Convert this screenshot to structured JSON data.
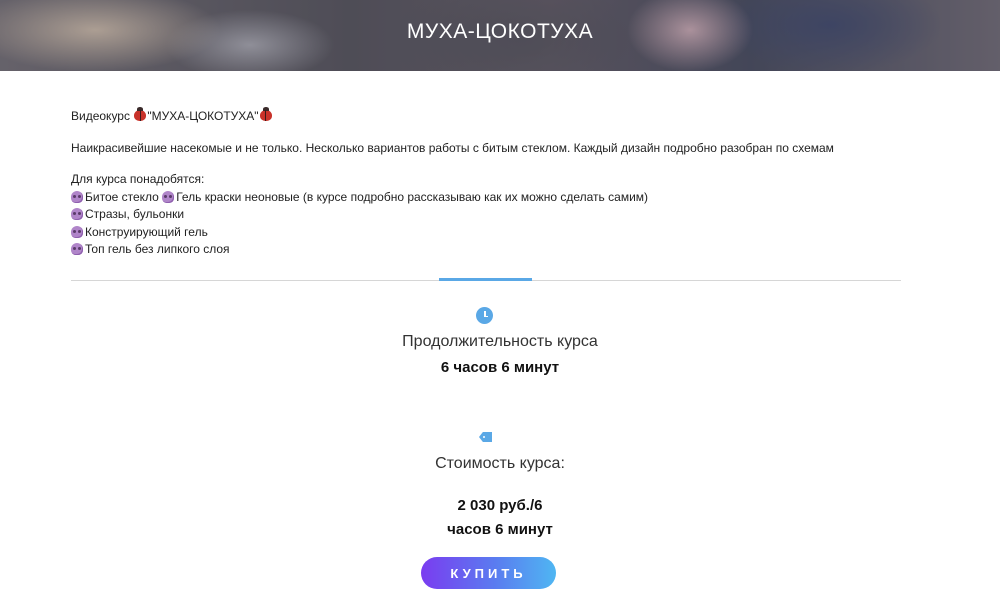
{
  "header": {
    "title": "МУХА-ЦОКОТУХА"
  },
  "description": {
    "intro_prefix": "Видеокурс ",
    "intro_title": "\"МУХА-ЦОКОТУХА\"",
    "summary": "Наикрасивейшие насекомые и не только. Несколько вариантов работы с битым стеклом. Каждый дизайн подробно разобран по схемам",
    "materials_heading": "Для курса понадобятся:",
    "materials_line1_a": "Битое стекло",
    "materials_line1_b": "Гель краски неоновые (в курсе подробно рассказываю как их можно сделать самим)",
    "materials": [
      "Стразы, бульонки",
      "Конструирующий гель",
      "Топ гель без липкого слоя"
    ]
  },
  "course": {
    "duration_label": "Продолжительность курса",
    "duration_value": "6 часов 6 минут",
    "price_label": "Стоимость курса:",
    "price_line1": "2 030 руб./6",
    "price_line2": "часов 6 минут",
    "buy_label": "КУПИТЬ"
  },
  "icons": {
    "duration": "clock-icon",
    "price": "price-tag-icon",
    "bullet": "purple-skull-emoji",
    "title_decoration": "ladybug-emoji"
  },
  "colors": {
    "accent": "#5aa8e6",
    "button_gradient_start": "#7a3cf0",
    "button_gradient_end": "#4fb6f2"
  }
}
